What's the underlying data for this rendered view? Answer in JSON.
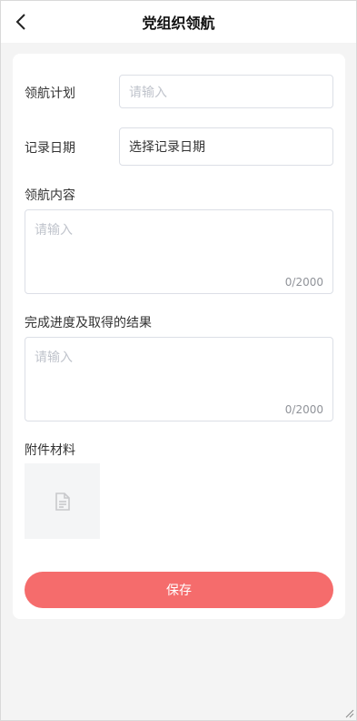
{
  "header": {
    "title": "党组织领航",
    "back_icon": "chevron-left-icon"
  },
  "form": {
    "plan": {
      "label": "领航计划",
      "placeholder": "请输入"
    },
    "record_date": {
      "label": "记录日期",
      "placeholder": "选择记录日期"
    },
    "content": {
      "label": "领航内容",
      "placeholder": "请输入",
      "counter": "0/2000"
    },
    "progress": {
      "label": "完成进度及取得的结果",
      "placeholder": "请输入",
      "counter": "0/2000"
    },
    "attachment": {
      "label": "附件材料",
      "icon": "document-icon"
    }
  },
  "actions": {
    "save_label": "保存"
  },
  "colors": {
    "accent": "#f56c6c",
    "background": "#f4f4f4",
    "card": "#ffffff",
    "placeholder": "#c0c4cc",
    "border": "#dcdfe6"
  }
}
